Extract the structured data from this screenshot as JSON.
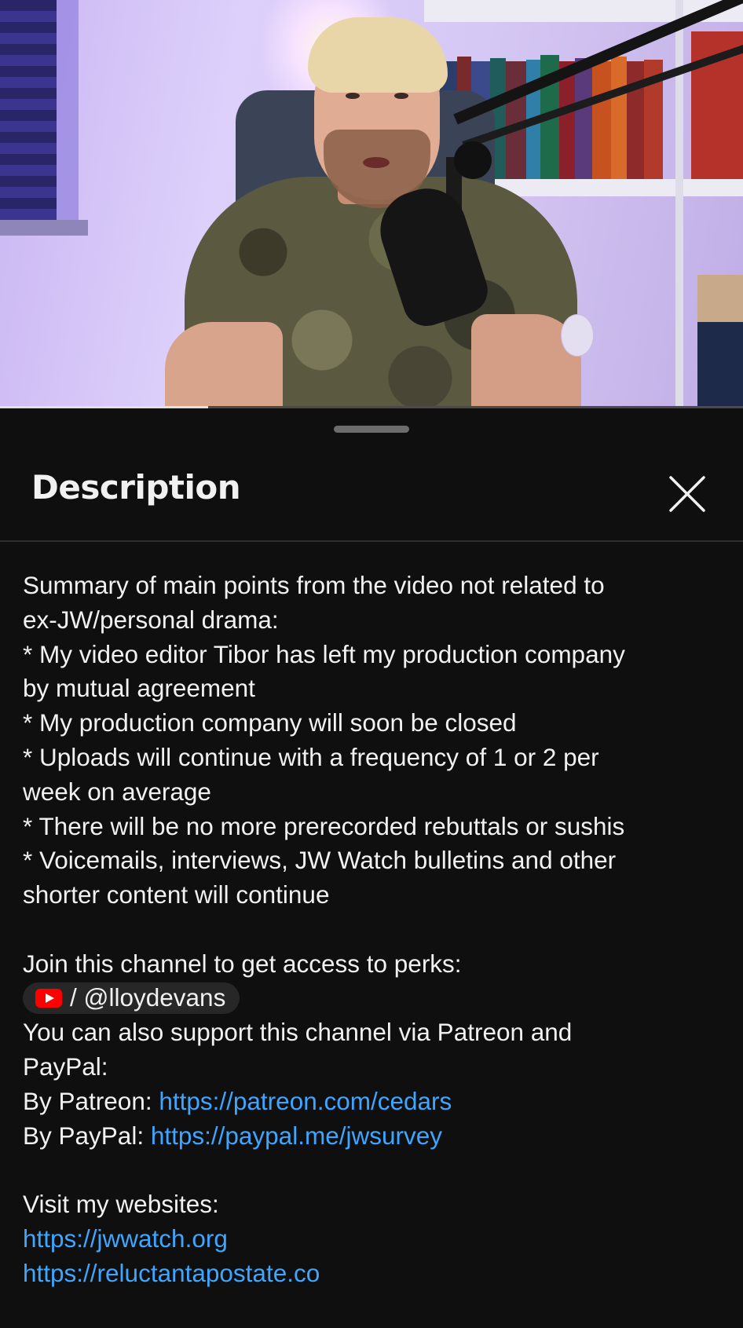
{
  "video": {
    "progress_fraction": 0.28
  },
  "sheet": {
    "title": "Description",
    "close_icon": "close-x-icon"
  },
  "description": {
    "intro_lines": [
      "Summary of main points from the video not related to",
      "ex-JW/personal drama:",
      "* My video editor Tibor has left my production company",
      "by mutual agreement",
      "* My production company will soon be closed",
      "* Uploads will continue with a frequency of 1 or 2 per",
      "week on average",
      "* There will be no more prerecorded rebuttals or sushis",
      "* Voicemails, interviews, JW Watch bulletins and other",
      "shorter content will continue"
    ],
    "join_text": "Join this channel to get access to perks:",
    "channel_chip": {
      "icon": "youtube-icon",
      "label": "/ @lloydevans"
    },
    "support_lines": [
      "You can also support this channel via Patreon and",
      "PayPal:"
    ],
    "patreon_label": "By Patreon: ",
    "patreon_url": "https://patreon.com/cedars",
    "paypal_label": "By PayPal: ",
    "paypal_url": "https://paypal.me/jwsurvey",
    "websites_heading": "Visit my websites:",
    "websites": [
      "https://jwwatch.org",
      "https://reluctantapostate.co"
    ]
  },
  "colors": {
    "background": "#0f0f0f",
    "text": "#f1f1f1",
    "link": "#3ea6ff",
    "chip": "#272727",
    "youtube_red": "#ff0000"
  }
}
